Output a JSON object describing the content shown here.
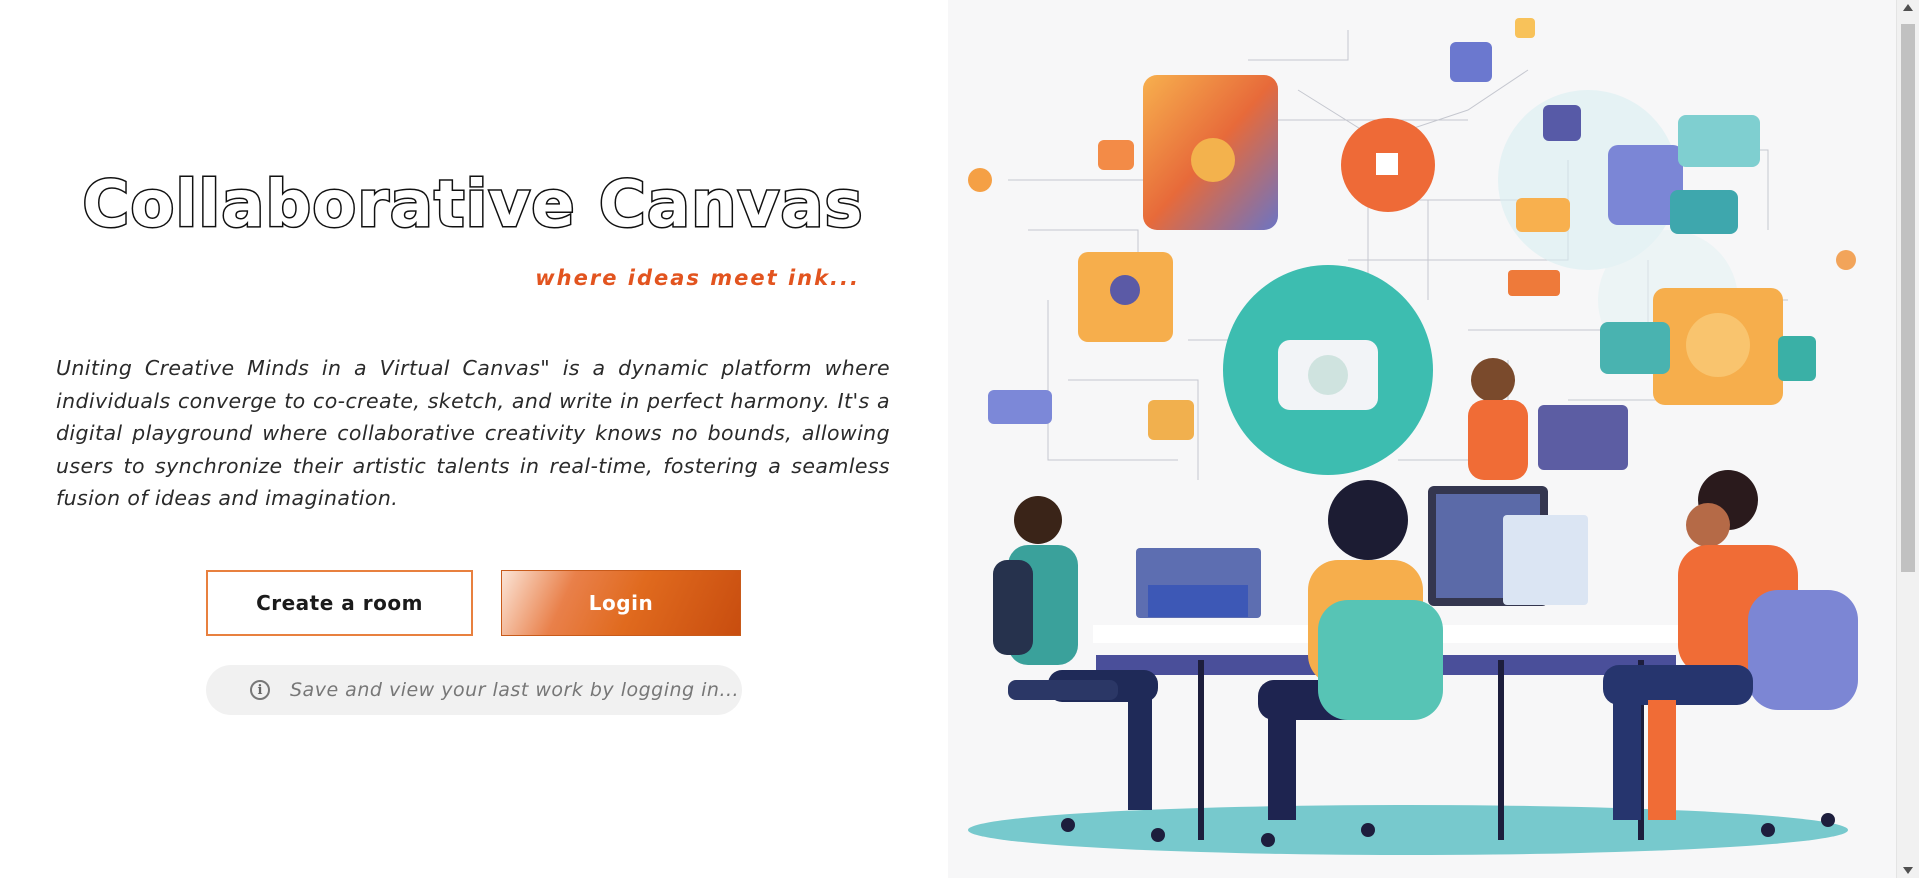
{
  "hero": {
    "title": "Collaborative Canvas",
    "tagline": "where ideas meet ink...",
    "description": "Uniting Creative Minds in a Virtual Canvas\" is a dynamic platform where individuals converge to co-create, sketch, and write in perfect harmony. It's a digital playground where collaborative creativity knows no bounds, allowing users to synchronize their artistic talents in real-time, fostering a seamless fusion of ideas and imagination."
  },
  "actions": {
    "create_room_label": "Create a room",
    "login_label": "Login"
  },
  "notice": {
    "icon": "info-icon",
    "text": "Save and view your last work by logging in..."
  },
  "colors": {
    "accent": "#e2541f",
    "button_border": "#e8803f",
    "teal": "#3dbdb0",
    "orange": "#f5a84a"
  }
}
